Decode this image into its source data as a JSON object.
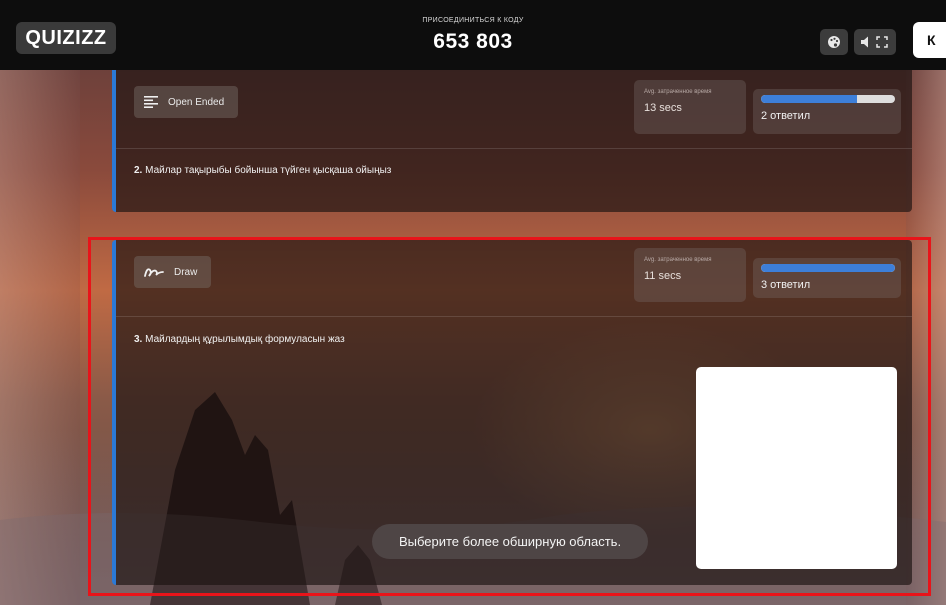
{
  "header": {
    "logo_text": "QUIZIZZ",
    "join_label": "ПРИСОЕДИНИТЬСЯ К КОДУ",
    "join_code": "653 803",
    "edge_button_text": "К",
    "buttons": [
      {
        "icon": "palette-icon"
      },
      {
        "icon": "volume-icon"
      },
      {
        "icon": "fullscreen-icon"
      }
    ]
  },
  "questions": [
    {
      "type_label": "Open Ended",
      "type_icon": "text-lines-icon",
      "time_label": "Avg. затраченное время",
      "time_value": "13 secs",
      "answered_fraction": 0.72,
      "answered_text": "2 ответил",
      "number": "2.",
      "text": "Майлар тақырыбы бойынша түйген қысқаша ойыңыз"
    },
    {
      "type_label": "Draw",
      "type_icon": "scribble-icon",
      "time_label": "Avg. затраченное время",
      "time_value": "11 secs",
      "answered_fraction": 1.0,
      "answered_text": "3 ответил",
      "number": "3.",
      "text": "Майлардың құрылымдық формуласын жаз"
    }
  ],
  "toast": {
    "message": "Выберите более обширную область."
  },
  "colors": {
    "accent": "#2b79d6",
    "progress": "#3d7fd9",
    "selection": "#e8141a"
  }
}
